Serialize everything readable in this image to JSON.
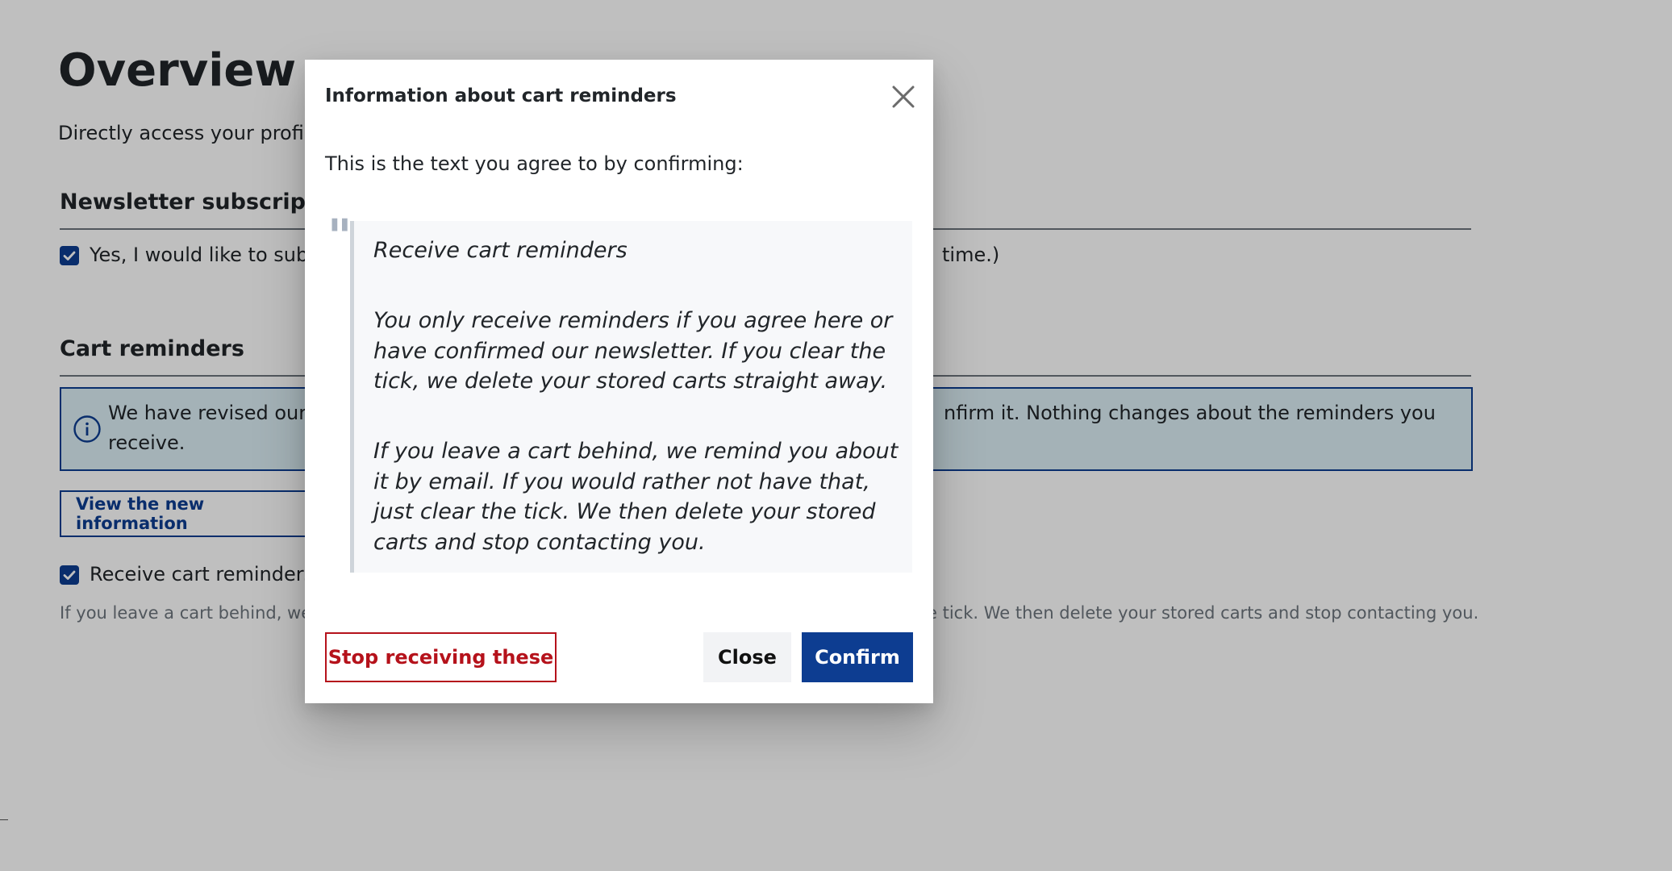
{
  "page": {
    "title": "Overview",
    "subtitle": "Directly access your profil",
    "newsletter": {
      "heading": "Newsletter subscriptio",
      "checkbox_label": "Yes, I would like to sub",
      "checkbox_label_tail": "time.)",
      "checked": true
    },
    "cart_reminders": {
      "heading": "Cart reminders",
      "info_text": "We have revised our receive.",
      "info_text_tail": "nfirm it. Nothing changes about the reminders you",
      "view_button_label": "View the new information",
      "checkbox_label": "Receive cart reminders",
      "checked": true,
      "helper_text": "If you leave a cart behind, we",
      "helper_text_tail": "e tick. We then delete your stored carts and stop contacting you."
    }
  },
  "modal": {
    "title": "Information about cart reminders",
    "intro": "This is the text you agree to by confirming:",
    "quote": {
      "heading": "Receive cart reminders",
      "paragraph_1": "You only receive reminders if you agree here or have confirmed our newsletter. If you clear the tick, we delete your stored carts straight away.",
      "paragraph_2": "If you leave a cart behind, we remind you about it by email. If you would rather not have that, just clear the tick. We then delete your stored carts and stop contacting you."
    },
    "buttons": {
      "stop_label": "Stop receiving these",
      "close_label": "Close",
      "confirm_label": "Confirm"
    }
  },
  "icons": {
    "close": "close-icon",
    "info": "info-icon",
    "check": "check-icon",
    "quote": "quote-icon"
  },
  "colors": {
    "primary": "#0d3d91",
    "danger": "#b5121b",
    "info_background": "#dbeef5",
    "muted_text": "#6c757d"
  }
}
